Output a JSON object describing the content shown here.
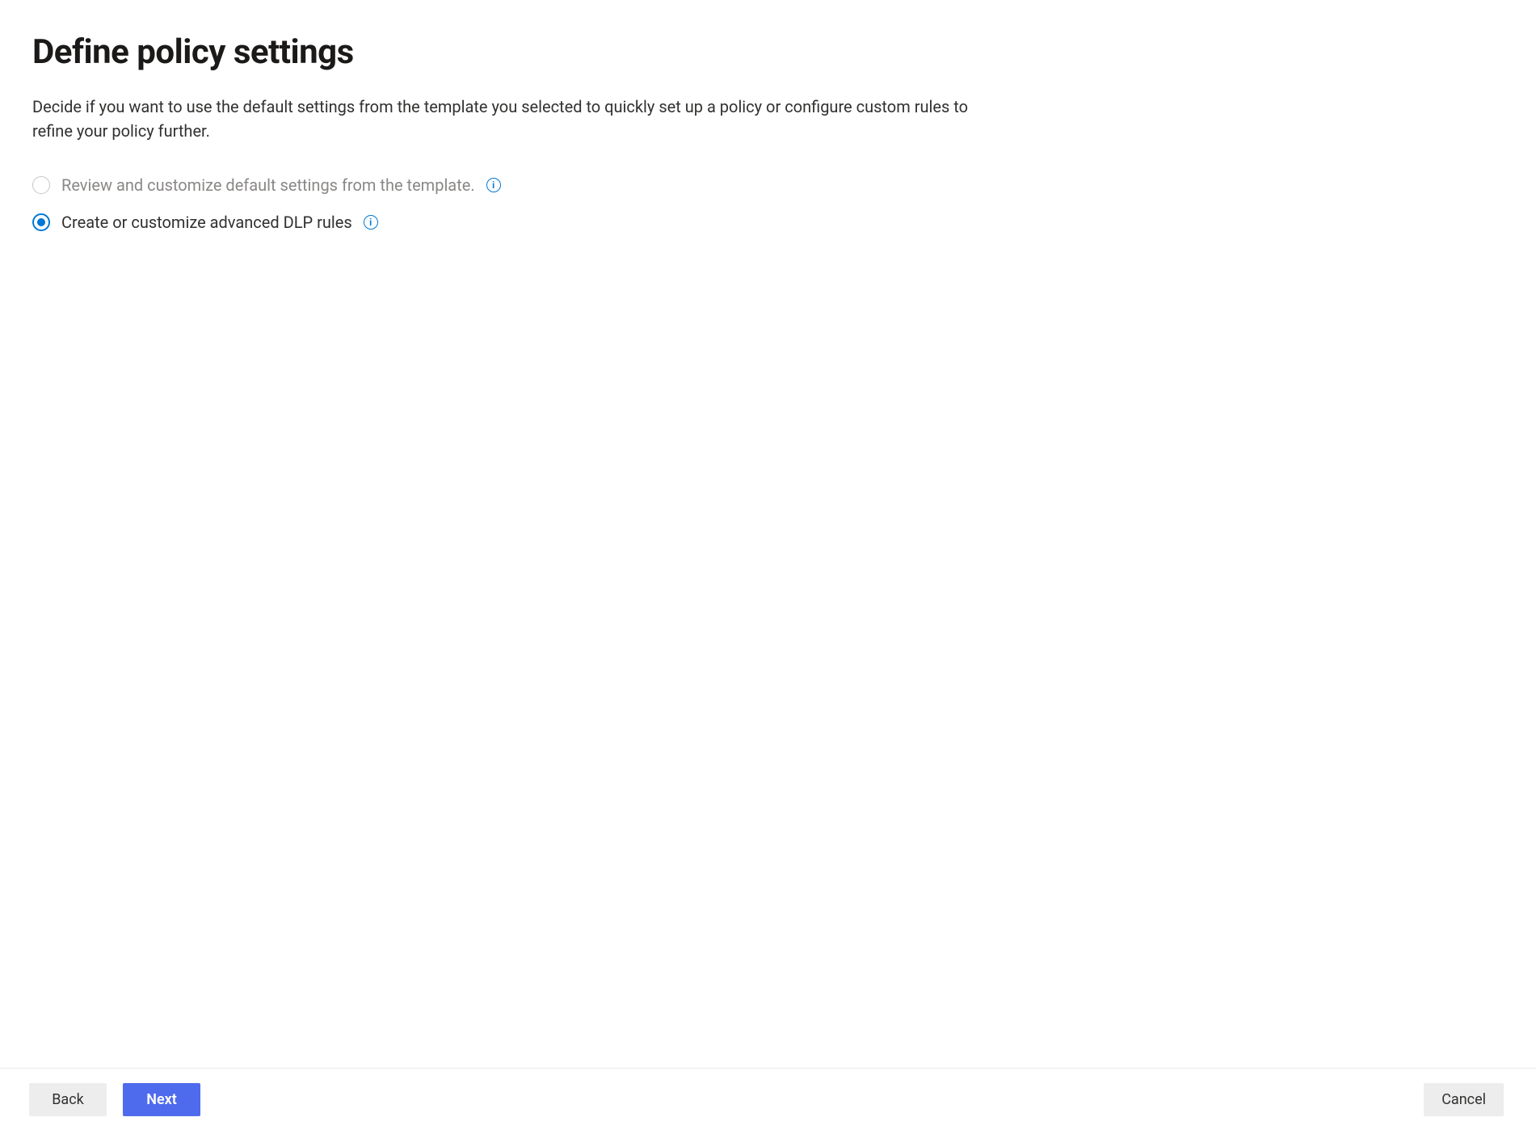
{
  "header": {
    "title": "Define policy settings",
    "description": "Decide if you want to use the default settings from the template you selected to quickly set up a policy or configure custom rules to refine your policy further."
  },
  "options": {
    "review_default": {
      "label": "Review and customize default settings from the template.",
      "selected": false,
      "disabled": true
    },
    "advanced_rules": {
      "label": "Create or customize advanced DLP rules",
      "selected": true,
      "disabled": false
    }
  },
  "footer": {
    "back_label": "Back",
    "next_label": "Next",
    "cancel_label": "Cancel"
  },
  "info_glyph": "i"
}
